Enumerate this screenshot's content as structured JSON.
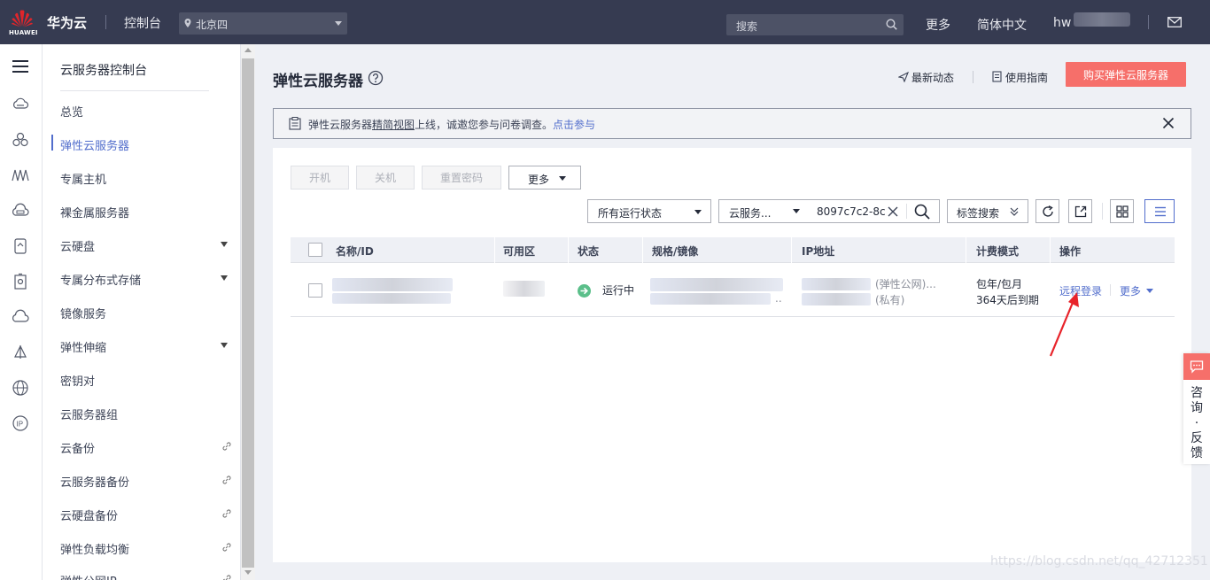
{
  "topbar": {
    "logo_text": "HUAWEI",
    "brand": "华为云",
    "console": "控制台",
    "region": "北京四",
    "search_placeholder": "搜索",
    "more": "更多",
    "language": "简体中文",
    "user": "hw"
  },
  "sidebar": {
    "title": "云服务器控制台",
    "items": [
      {
        "label": "总览"
      },
      {
        "label": "弹性云服务器",
        "active": true
      },
      {
        "label": "专属主机"
      },
      {
        "label": "裸金属服务器"
      },
      {
        "label": "云硬盘",
        "expandable": true
      },
      {
        "label": "专属分布式存储",
        "expandable": true
      },
      {
        "label": "镜像服务"
      },
      {
        "label": "弹性伸缩",
        "expandable": true
      },
      {
        "label": "密钥对"
      },
      {
        "label": "云服务器组"
      },
      {
        "label": "云备份",
        "external": true
      },
      {
        "label": "云服务器备份",
        "external": true
      },
      {
        "label": "云硬盘备份",
        "external": true
      },
      {
        "label": "弹性负载均衡",
        "external": true
      },
      {
        "label": "弹性公网IP",
        "external": true
      }
    ]
  },
  "header": {
    "title": "弹性云服务器",
    "latest_news": "最新动态",
    "guide": "使用指南",
    "buy_button": "购买弹性云服务器"
  },
  "notice": {
    "prefix": "弹性云服务器",
    "link1": "精简视图",
    "middle": "上线，诚邀您参与问卷调查。",
    "link2": "点击参与"
  },
  "toolbar": {
    "start": "开机",
    "stop": "关机",
    "reset_password": "重置密码",
    "more": "更多",
    "status_filter": "所有运行状态",
    "search_property": "云服务...",
    "search_value": "8097c7c2-8c",
    "tag_search": "标签搜索"
  },
  "table": {
    "columns": [
      "名称/ID",
      "可用区",
      "状态",
      "规格/镜像",
      "IP地址",
      "计费模式",
      "操作"
    ],
    "rows": [
      {
        "status": "运行中",
        "ip_public_suffix": "(弹性公网)...",
        "ip_private_suffix": "(私有)",
        "billing": "包年/包月",
        "expiry": "364天后到期",
        "action_remote": "远程登录",
        "action_more": "更多",
        "spec_suffix": ".."
      }
    ]
  },
  "feedback": {
    "label": "咨询·反馈"
  },
  "watermark": "https://blog.csdn.net/qq_42712351",
  "colors": {
    "topbar_bg": "#363b51",
    "accent": "#526ecc",
    "buy_button": "#f66f6a",
    "running_green": "#5bbf8a"
  }
}
